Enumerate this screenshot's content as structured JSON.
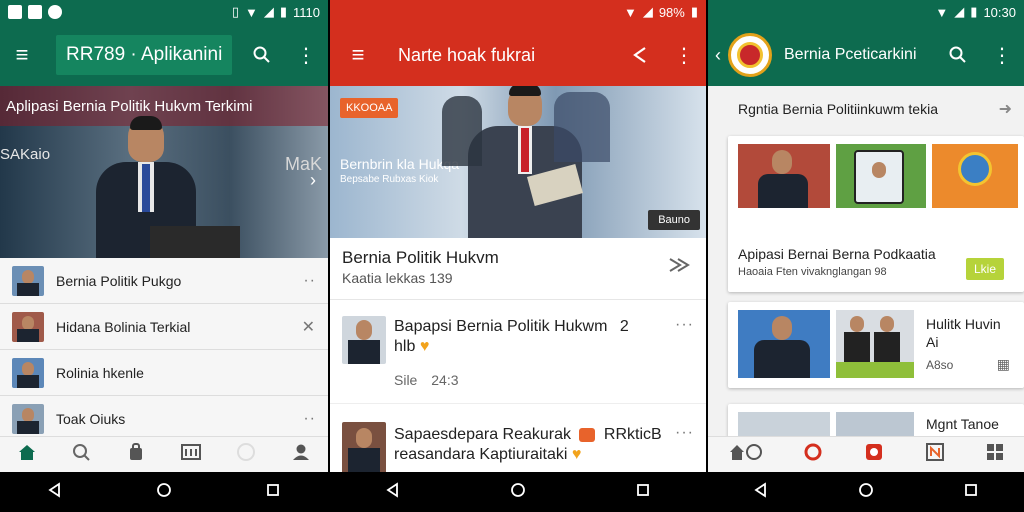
{
  "screen1": {
    "status": {
      "time": "1110",
      "left_icons": [
        "A",
        "Z",
        "C"
      ]
    },
    "appbar": {
      "title": "RR789 · Aplikanini",
      "bg": "#0d6b4f"
    },
    "hero": {
      "title": "Aplipasi Bernia Politik Hukvm Terkimi",
      "left_text": "SAKaio",
      "right_text": "MaK"
    },
    "list": [
      {
        "label": "Bernia Politik Pukgo",
        "action": "··"
      },
      {
        "label": "Hidana Bolinia Terkial",
        "action": "✕"
      },
      {
        "label": "Rolinia hkenle",
        "action": ""
      },
      {
        "label": "Toak Oiuks",
        "action": "··"
      }
    ],
    "bottomnav": [
      "home-icon",
      "search-icon",
      "bag-icon",
      "news-icon",
      "circle-icon",
      "profile-icon"
    ]
  },
  "screen2": {
    "status": {
      "time": "98%"
    },
    "appbar": {
      "title": "Narte hoak fukrai",
      "bg": "#d42f1e"
    },
    "hero": {
      "badge": "KKOOAA",
      "caption_title": "Bernbrin kla Hukqa",
      "caption_sub": "Bepsabe Rubxas Kiok",
      "button": "Bauno"
    },
    "headline": {
      "title": "Bernia Politik Hukvm",
      "sub": "Kaatia lekkas 139"
    },
    "articles": [
      {
        "title": "Bapapsi Bernia Politik Hukwm",
        "extra": "2",
        "sub": "hlb",
        "meta": "Sile",
        "time": "24:3"
      },
      {
        "title": "Sapaesdepara Reakurak",
        "extra": "RRkticB",
        "sub": "reasandara Kaptiuraitaki"
      }
    ]
  },
  "screen3": {
    "status": {
      "time": "10:30"
    },
    "appbar": {
      "title": "Bernia Pceticarkini",
      "bg": "#0d6b4f"
    },
    "section_title": "Rgntia Bernia Politiinkuwm tekia",
    "card1": {
      "title": "Apipasi Bernai Berna Podkaatia",
      "sub": "Haoaia Ften vivaknglangan 98",
      "button": "Lkie"
    },
    "card2": {
      "title": "Hulitk Huvin",
      "sub": "Ai",
      "meta": "A8so"
    },
    "card3": {
      "title": "Mgnt Tanoe"
    }
  },
  "colors": {
    "green": "#0d6b4f",
    "red": "#d42f1e",
    "accent_lime": "#b6d33a"
  }
}
